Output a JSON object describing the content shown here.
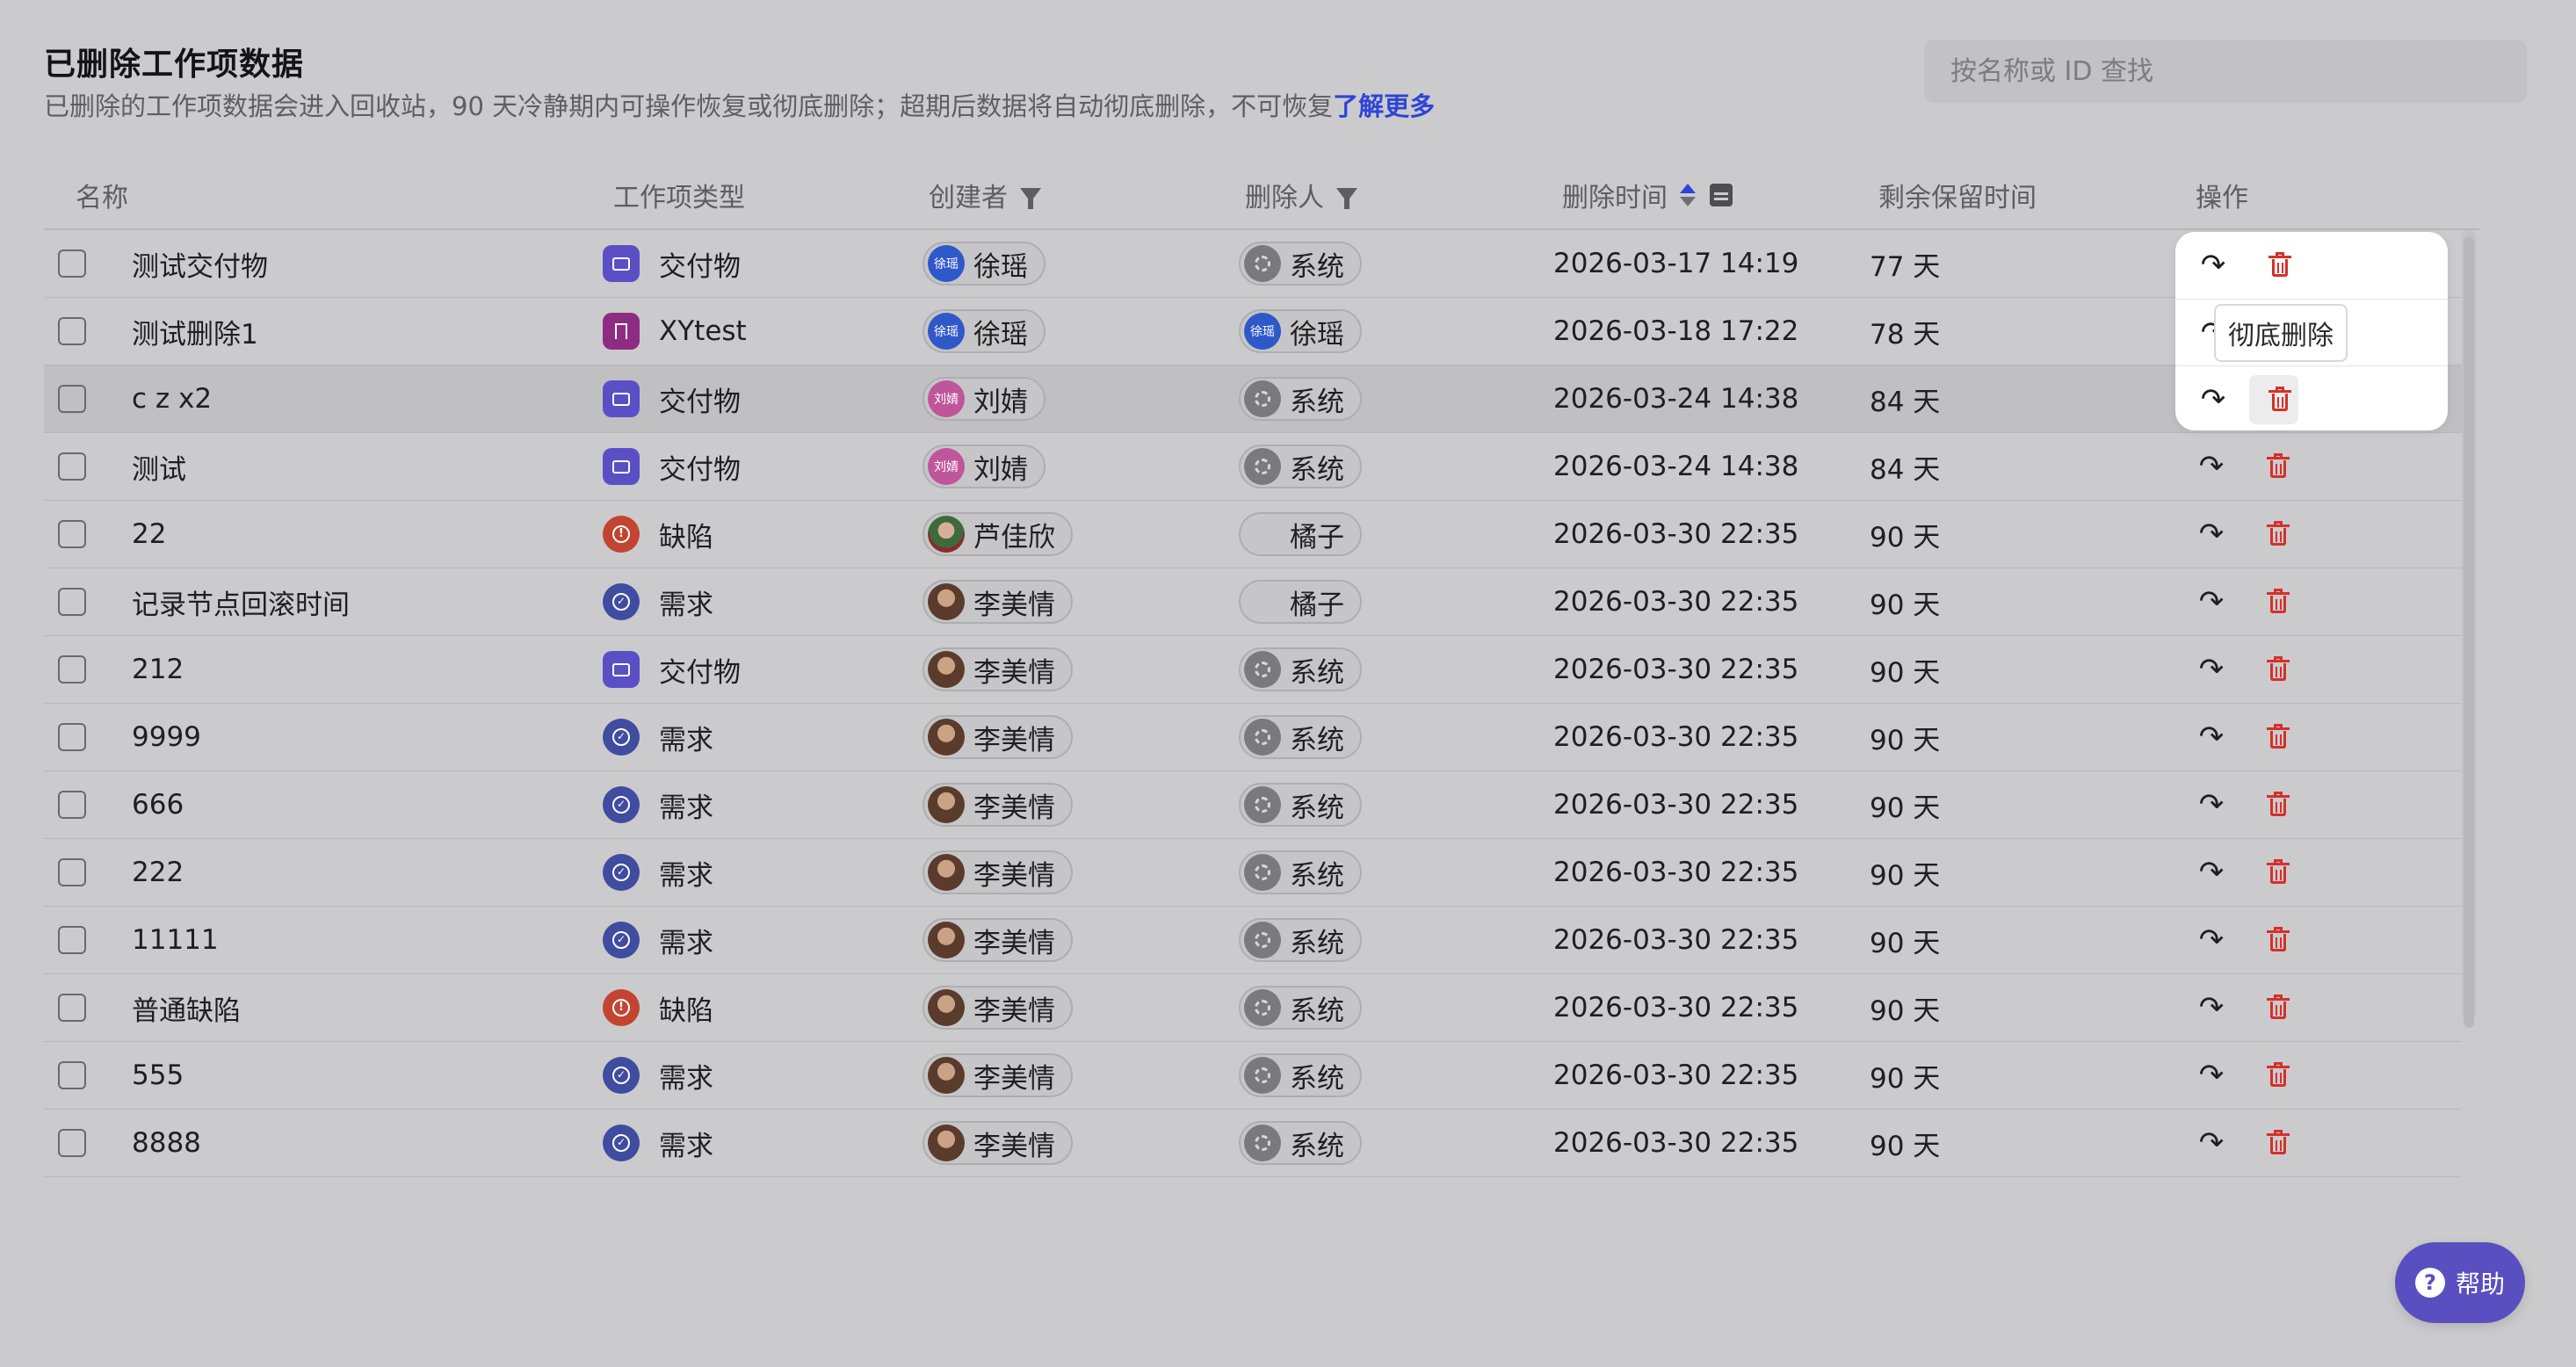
{
  "header": {
    "title": "已删除工作项数据",
    "subtitle": "已删除的工作项数据会进入回收站，90 天冷静期内可操作恢复或彻底删除；超期后数据将自动彻底删除，不可恢复",
    "learn_more": "了解更多"
  },
  "search": {
    "placeholder": "按名称或 ID 查找"
  },
  "columns": {
    "name": "名称",
    "type": "工作项类型",
    "creator": "创建者",
    "deleter": "删除人",
    "deleted_time": "删除时间",
    "retention": "剩余保留时间",
    "actions": "操作"
  },
  "sort": {
    "deleted_time": "ascending"
  },
  "tooltip": {
    "text": "彻底删除"
  },
  "help": {
    "label": "帮助"
  },
  "icons": {
    "restore": "restore-arrow-icon",
    "delete": "trash-icon",
    "filter": "filter-icon",
    "calendar": "calendar-icon",
    "help": "question-icon"
  },
  "colors": {
    "link": "#2e45d6",
    "delete_red": "#d5302a",
    "deliverable": "#5b4fc6",
    "xytest": "#8e2c83",
    "bug": "#c24431",
    "requirement": "#404ca0",
    "help_button": "#5a4fc0"
  },
  "rows": [
    {
      "name": "测试交付物",
      "type": "交付物",
      "type_kind": "deliverable",
      "creator": "徐瑶",
      "creator_avatar": "徐瑶",
      "creator_kind": "blue",
      "deleter": "系统",
      "deleter_avatar": "",
      "deleter_kind": "gear",
      "deleted_time": "2026-03-17 14:19",
      "retention": "77 天"
    },
    {
      "name": "测试删除1",
      "type": "XYtest",
      "type_kind": "xytest",
      "creator": "徐瑶",
      "creator_avatar": "徐瑶",
      "creator_kind": "blue",
      "deleter": "徐瑶",
      "deleter_avatar": "徐瑶",
      "deleter_kind": "blue",
      "deleted_time": "2026-03-18 17:22",
      "retention": "78 天"
    },
    {
      "name": "c z x2",
      "type": "交付物",
      "type_kind": "deliverable",
      "creator": "刘婧",
      "creator_avatar": "刘婧",
      "creator_kind": "pink",
      "deleter": "系统",
      "deleter_avatar": "",
      "deleter_kind": "gear",
      "deleted_time": "2026-03-24 14:38",
      "retention": "84 天"
    },
    {
      "name": "测试",
      "type": "交付物",
      "type_kind": "deliverable",
      "creator": "刘婧",
      "creator_avatar": "刘婧",
      "creator_kind": "pink",
      "deleter": "系统",
      "deleter_avatar": "",
      "deleter_kind": "gear",
      "deleted_time": "2026-03-24 14:38",
      "retention": "84 天"
    },
    {
      "name": "22",
      "type": "缺陷",
      "type_kind": "bug",
      "creator": "芦佳欣",
      "creator_avatar": "",
      "creator_kind": "photo2",
      "deleter": "橘子",
      "deleter_avatar": "",
      "deleter_kind": "blank",
      "deleted_time": "2026-03-30 22:35",
      "retention": "90 天"
    },
    {
      "name": "记录节点回滚时间",
      "type": "需求",
      "type_kind": "req",
      "creator": "李美情",
      "creator_avatar": "",
      "creator_kind": "photo",
      "deleter": "橘子",
      "deleter_avatar": "",
      "deleter_kind": "blank",
      "deleted_time": "2026-03-30 22:35",
      "retention": "90 天"
    },
    {
      "name": "212",
      "type": "交付物",
      "type_kind": "deliverable",
      "creator": "李美情",
      "creator_avatar": "",
      "creator_kind": "photo",
      "deleter": "系统",
      "deleter_avatar": "",
      "deleter_kind": "gear",
      "deleted_time": "2026-03-30 22:35",
      "retention": "90 天"
    },
    {
      "name": "9999",
      "type": "需求",
      "type_kind": "req",
      "creator": "李美情",
      "creator_avatar": "",
      "creator_kind": "photo",
      "deleter": "系统",
      "deleter_avatar": "",
      "deleter_kind": "gear",
      "deleted_time": "2026-03-30 22:35",
      "retention": "90 天"
    },
    {
      "name": "666",
      "type": "需求",
      "type_kind": "req",
      "creator": "李美情",
      "creator_avatar": "",
      "creator_kind": "photo",
      "deleter": "系统",
      "deleter_avatar": "",
      "deleter_kind": "gear",
      "deleted_time": "2026-03-30 22:35",
      "retention": "90 天"
    },
    {
      "name": "222",
      "type": "需求",
      "type_kind": "req",
      "creator": "李美情",
      "creator_avatar": "",
      "creator_kind": "photo",
      "deleter": "系统",
      "deleter_avatar": "",
      "deleter_kind": "gear",
      "deleted_time": "2026-03-30 22:35",
      "retention": "90 天"
    },
    {
      "name": "11111",
      "type": "需求",
      "type_kind": "req",
      "creator": "李美情",
      "creator_avatar": "",
      "creator_kind": "photo",
      "deleter": "系统",
      "deleter_avatar": "",
      "deleter_kind": "gear",
      "deleted_time": "2026-03-30 22:35",
      "retention": "90 天"
    },
    {
      "name": "普通缺陷",
      "type": "缺陷",
      "type_kind": "bug",
      "creator": "李美情",
      "creator_avatar": "",
      "creator_kind": "photo",
      "deleter": "系统",
      "deleter_avatar": "",
      "deleter_kind": "gear",
      "deleted_time": "2026-03-30 22:35",
      "retention": "90 天"
    },
    {
      "name": "555",
      "type": "需求",
      "type_kind": "req",
      "creator": "李美情",
      "creator_avatar": "",
      "creator_kind": "photo",
      "deleter": "系统",
      "deleter_avatar": "",
      "deleter_kind": "gear",
      "deleted_time": "2026-03-30 22:35",
      "retention": "90 天"
    },
    {
      "name": "8888",
      "type": "需求",
      "type_kind": "req",
      "creator": "李美情",
      "creator_avatar": "",
      "creator_kind": "photo",
      "deleter": "系统",
      "deleter_avatar": "",
      "deleter_kind": "gear",
      "deleted_time": "2026-03-30 22:35",
      "retention": "90 天"
    }
  ]
}
